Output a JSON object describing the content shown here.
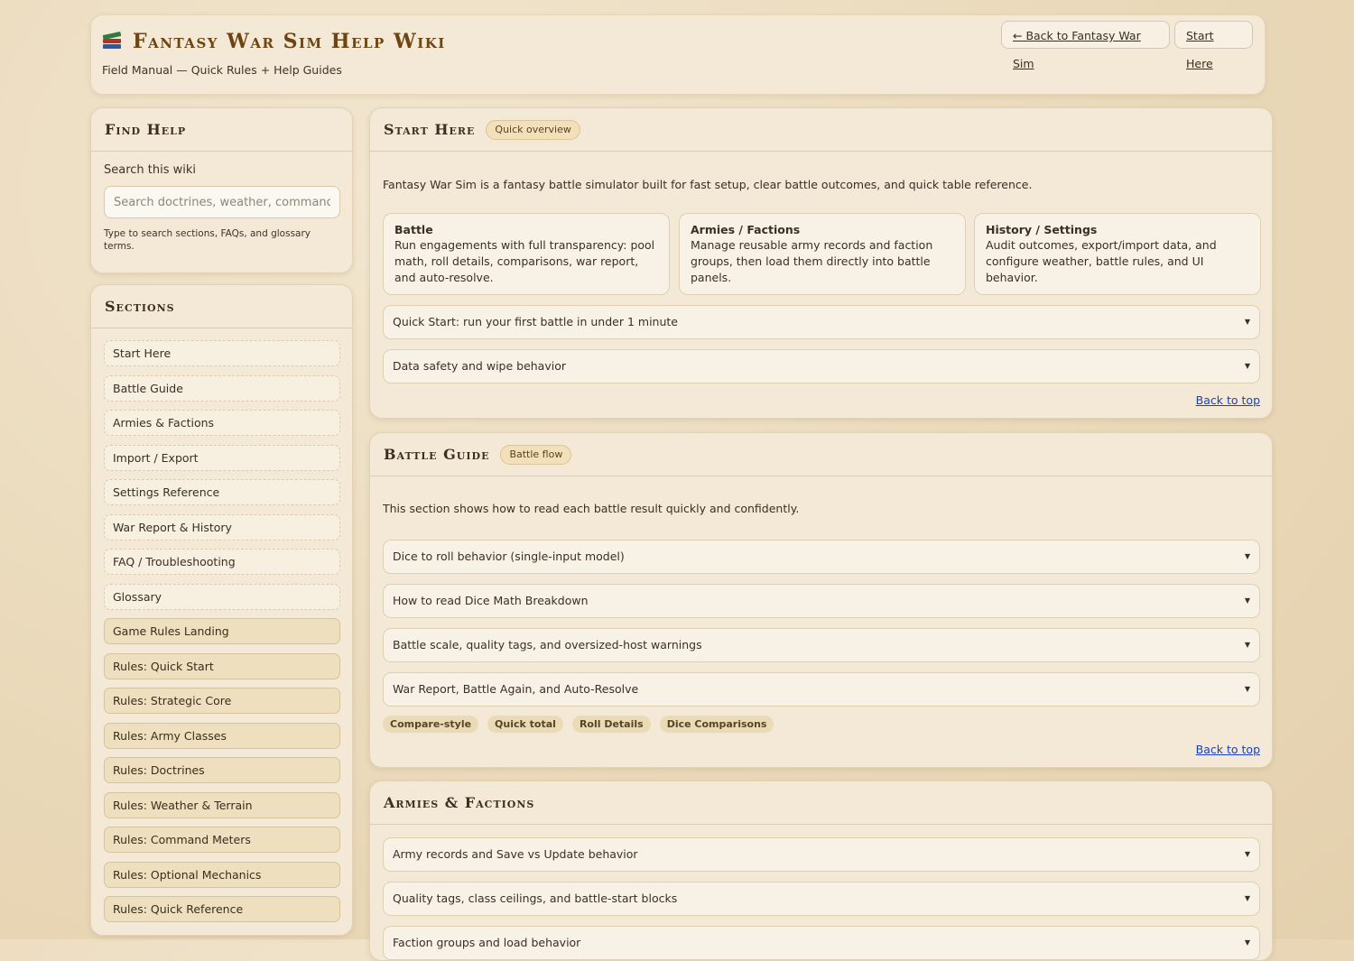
{
  "header": {
    "title": "Fantasy War Sim Help Wiki",
    "subtitle": "Field Manual — Quick Rules + Help Guides",
    "back_button": "← Back to Fantasy War Sim",
    "start_button": "Start Here"
  },
  "find_help": {
    "title": "Find Help",
    "search_label": "Search this wiki",
    "search_placeholder": "Search doctrines, weather, commands",
    "hint": "Type to search sections, FAQs, and glossary terms."
  },
  "sections": {
    "title": "Sections",
    "items": [
      {
        "label": "Start Here",
        "kind": "sec"
      },
      {
        "label": "Battle Guide",
        "kind": "sec"
      },
      {
        "label": "Armies & Factions",
        "kind": "sec"
      },
      {
        "label": "Import / Export",
        "kind": "sec"
      },
      {
        "label": "Settings Reference",
        "kind": "sec"
      },
      {
        "label": "War Report & History",
        "kind": "sec"
      },
      {
        "label": "FAQ / Troubleshooting",
        "kind": "sec"
      },
      {
        "label": "Glossary",
        "kind": "sec"
      },
      {
        "label": "Game Rules Landing",
        "kind": "rule"
      },
      {
        "label": "Rules: Quick Start",
        "kind": "rule"
      },
      {
        "label": "Rules: Strategic Core",
        "kind": "rule"
      },
      {
        "label": "Rules: Army Classes",
        "kind": "rule"
      },
      {
        "label": "Rules: Doctrines",
        "kind": "rule"
      },
      {
        "label": "Rules: Weather & Terrain",
        "kind": "rule"
      },
      {
        "label": "Rules: Command Meters",
        "kind": "rule"
      },
      {
        "label": "Rules: Optional Mechanics",
        "kind": "rule"
      },
      {
        "label": "Rules: Quick Reference",
        "kind": "rule"
      }
    ]
  },
  "start_here": {
    "title": "Start Here",
    "tag": "Quick overview",
    "intro": "Fantasy War Sim is a fantasy battle simulator built for fast setup, clear battle outcomes, and quick table reference.",
    "cards": [
      {
        "title": "Battle",
        "desc": "Run engagements with full transparency: pool math, roll details, comparisons, war report, and auto-resolve."
      },
      {
        "title": "Armies / Factions",
        "desc": "Manage reusable army records and faction groups, then load them directly into battle panels."
      },
      {
        "title": "History / Settings",
        "desc": "Audit outcomes, export/import data, and configure weather, battle rules, and UI behavior."
      }
    ],
    "accordions": [
      "Quick Start: run your first battle in under 1 minute",
      "Data safety and wipe behavior"
    ],
    "back_to_top": "Back to top"
  },
  "battle_guide": {
    "title": "Battle Guide",
    "tag": "Battle flow",
    "intro": "This section shows how to read each battle result quickly and confidently.",
    "accordions": [
      "Dice to roll behavior (single-input model)",
      "How to read Dice Math Breakdown",
      "Battle scale, quality tags, and oversized-host warnings",
      "War Report, Battle Again, and Auto-Resolve"
    ],
    "chips": [
      "Compare-style",
      "Quick total",
      "Roll Details",
      "Dice Comparisons"
    ],
    "back_to_top": "Back to top"
  },
  "armies_factions": {
    "title": "Armies & Factions",
    "accordions": [
      "Army records and Save vs Update behavior",
      "Quality tags, class ceilings, and battle-start blocks",
      "Faction groups and load behavior"
    ]
  },
  "colors": {
    "accent": "#6e4511",
    "link": "#1a3fbf",
    "panel": "#f3e9d6",
    "background": "#ecdcbf"
  },
  "icons": {
    "brand": "books-icon",
    "caret": "caret-down-icon"
  }
}
